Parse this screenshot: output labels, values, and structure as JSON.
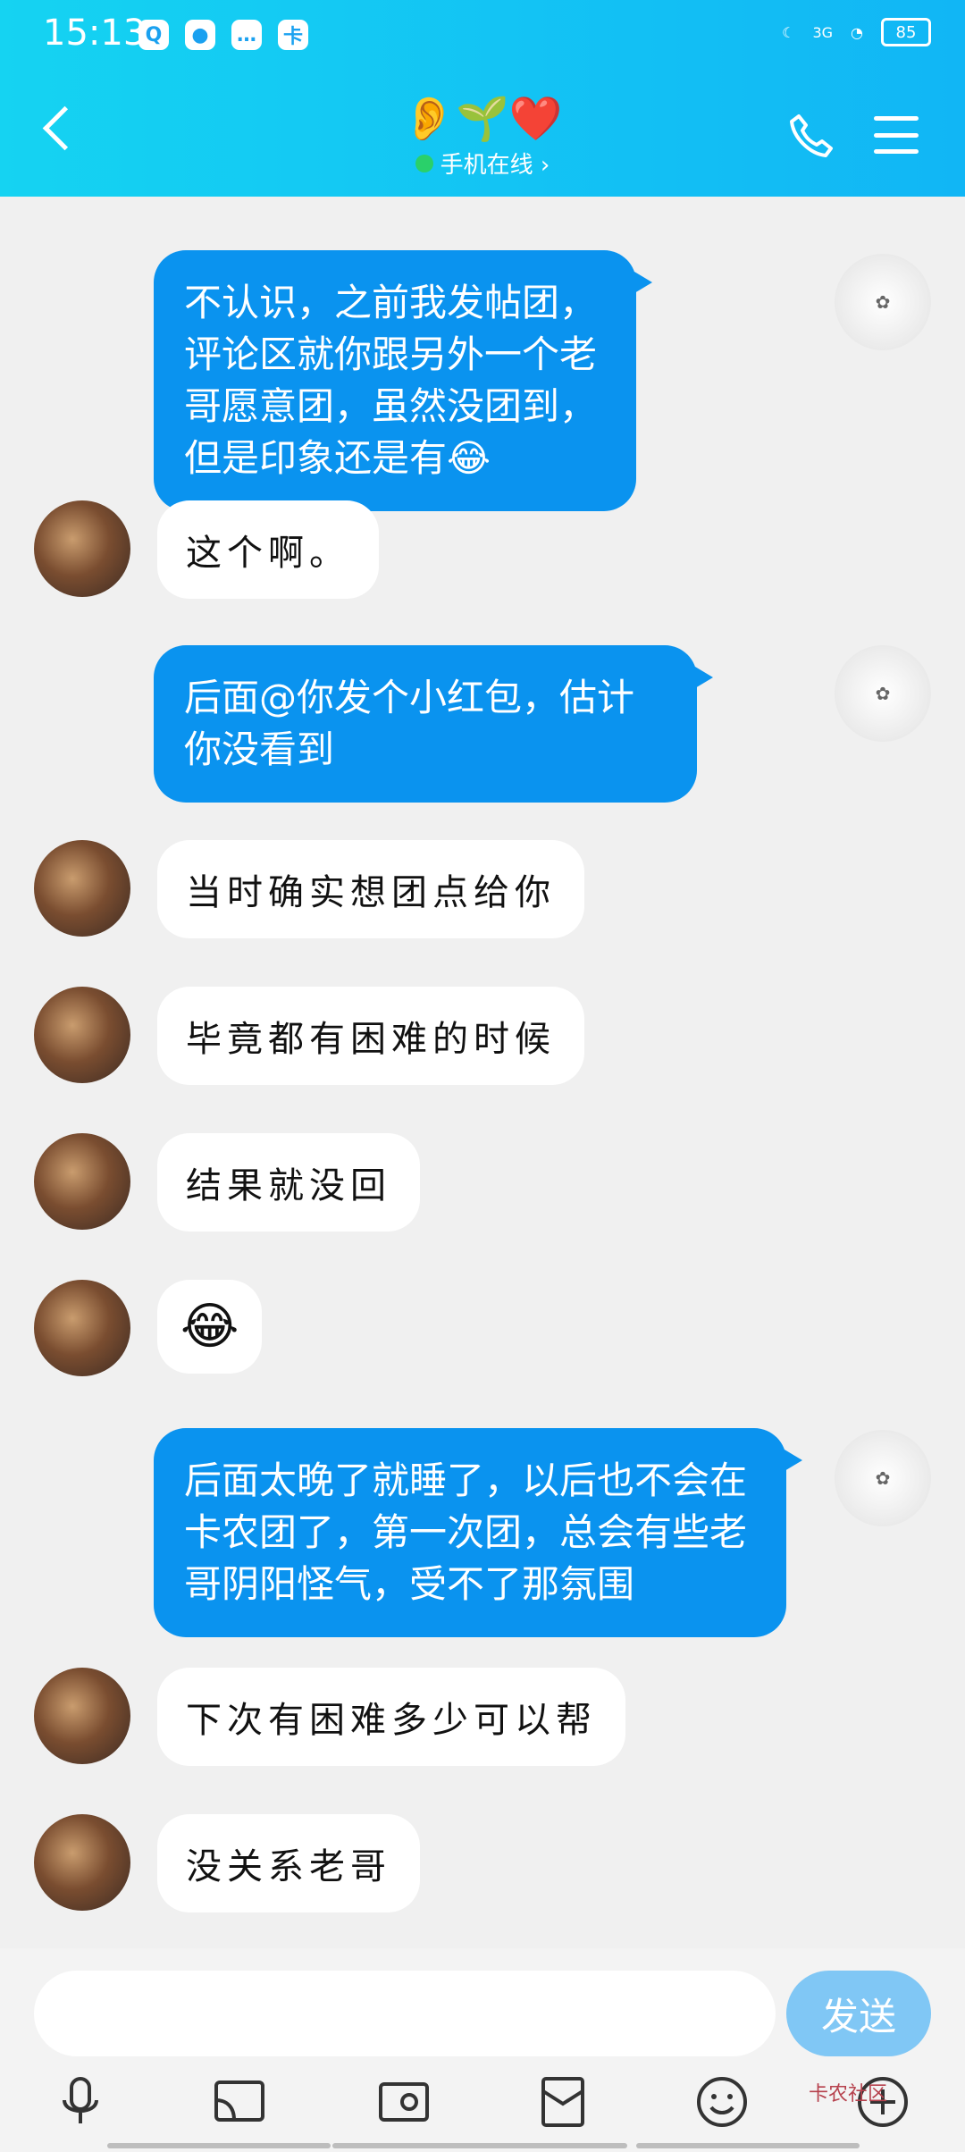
{
  "status_bar": {
    "time": "15:13",
    "battery": "85",
    "network": "3G"
  },
  "header": {
    "title_icons": "👂🌱❤️",
    "status": "手机在线 ›"
  },
  "messages": [
    {
      "side": "right",
      "text": "不认识，之前我发帖团，评论区就你跟另外一个老哥愿意团，虽然没团到，但是印象还是有😂"
    },
    {
      "side": "left",
      "text": "这个啊。"
    },
    {
      "side": "right",
      "text": "后面@你发个小红包，估计你没看到"
    },
    {
      "side": "left",
      "text": "当时确实想团点给你"
    },
    {
      "side": "left",
      "text": "毕竟都有困难的时候"
    },
    {
      "side": "left",
      "text": "结果就没回"
    },
    {
      "side": "left",
      "text": "😂"
    },
    {
      "side": "right",
      "text": "后面太晚了就睡了，以后也不会在卡农团了，第一次团，总会有些老哥阴阳怪气，受不了那氛围"
    },
    {
      "side": "left",
      "text": "下次有困难多少可以帮"
    },
    {
      "side": "left",
      "text": "没关系老哥"
    }
  ],
  "input": {
    "send_label": "发送",
    "placeholder": ""
  },
  "watermark": "卡农社区",
  "colors": {
    "header": "#11b6f5",
    "bubble_right": "#0a93ef",
    "bubble_left": "#ffffff"
  }
}
